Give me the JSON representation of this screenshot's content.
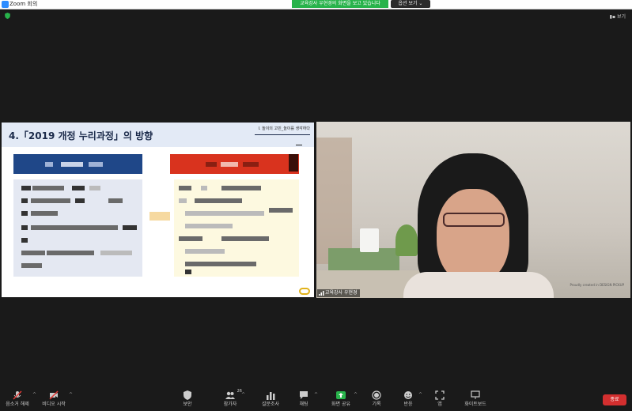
{
  "window": {
    "title": "Zoom 회의"
  },
  "banner": {
    "text": "교육강사 우현경의 화면을 보고 있습니다",
    "view_options": "옵션 보기 ⌄"
  },
  "view_button": "보기",
  "slide": {
    "title": "4.「2019 개정 누리과정」의 방향",
    "section": "Ⅰ. 놀이의 고민_놀이를 생각하다"
  },
  "participant": {
    "name": "교육강사 우현경"
  },
  "watermark": "Proudly created in DESIGN PICKUP",
  "toolbar": {
    "mute": "음소거 해제",
    "video": "비디오 시작",
    "security": "보안",
    "participants": "참가자",
    "participants_count": "26",
    "polls": "설문조사",
    "chat": "채팅",
    "share": "화면 공유",
    "record": "기록",
    "reactions": "반응",
    "apps": "앱",
    "whiteboard": "화이트보드",
    "end": "종료"
  }
}
